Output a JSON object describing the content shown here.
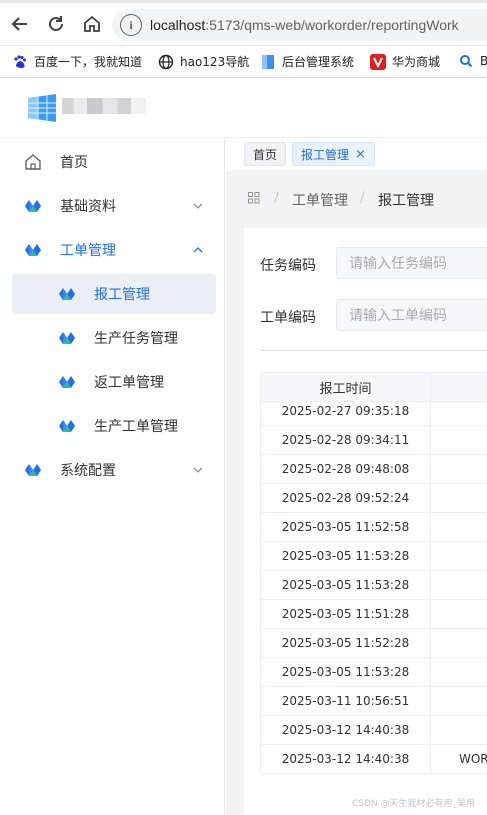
{
  "browser": {
    "url_host": "localhost",
    "url_path": ":5173/qms-web/workorder/reportingWork",
    "bookmarks": [
      {
        "label": "百度一下，我就知道",
        "icon": "baidu-paw-icon"
      },
      {
        "label": "hao123导航",
        "icon": "globe-icon"
      },
      {
        "label": "后台管理系统",
        "icon": "blue-page-icon"
      },
      {
        "label": "华为商城",
        "icon": "huawei-vmall-icon"
      },
      {
        "label": "Bi",
        "icon": "search-icon"
      }
    ]
  },
  "sidebar": {
    "items": [
      {
        "label": "首页",
        "icon": "home-icon"
      },
      {
        "label": "基础资料",
        "icon": "diamond-logo-icon"
      },
      {
        "label": "工单管理",
        "icon": "diamond-logo-icon"
      },
      {
        "label": "报工管理",
        "icon": "diamond-logo-icon"
      },
      {
        "label": "生产任务管理",
        "icon": "diamond-logo-icon"
      },
      {
        "label": "返工单管理",
        "icon": "diamond-logo-icon"
      },
      {
        "label": "生产工单管理",
        "icon": "diamond-logo-icon"
      },
      {
        "label": "系统配置",
        "icon": "diamond-logo-icon"
      }
    ]
  },
  "tags": {
    "home": "首页",
    "current": "报工管理",
    "close_glyph": "×"
  },
  "breadcrumb": {
    "icon": "grid-icon",
    "sep": "/",
    "level1": "工单管理",
    "level2": "报工管理"
  },
  "form": {
    "task_code_label": "任务编码",
    "task_code_placeholder": "请输入任务编码",
    "order_code_label": "工单编码",
    "order_code_placeholder": "请输入工单编码"
  },
  "table": {
    "header": "报工时间",
    "rows": [
      {
        "time": "2025-02-27 09:35:18",
        "col2": ""
      },
      {
        "time": "2025-02-28 09:34:11",
        "col2": ""
      },
      {
        "time": "2025-02-28 09:48:08",
        "col2": ""
      },
      {
        "time": "2025-02-28 09:52:24",
        "col2": ""
      },
      {
        "time": "2025-03-05 11:52:58",
        "col2": ""
      },
      {
        "time": "2025-03-05 11:53:28",
        "col2": ""
      },
      {
        "time": "2025-03-05 11:53:28",
        "col2": ""
      },
      {
        "time": "2025-03-05 11:51:28",
        "col2": ""
      },
      {
        "time": "2025-03-05 11:52:28",
        "col2": ""
      },
      {
        "time": "2025-03-05 11:53:28",
        "col2": ""
      },
      {
        "time": "2025-03-11 10:56:51",
        "col2": ""
      },
      {
        "time": "2025-03-12 14:40:38",
        "col2": ""
      },
      {
        "time": "2025-03-12 14:40:38",
        "col2": "WOR"
      }
    ]
  },
  "watermark": "CSDN @天生我材必有用_吴用",
  "colors": {
    "accent": "#1f6fe6",
    "active_bg": "#ebeef5"
  }
}
